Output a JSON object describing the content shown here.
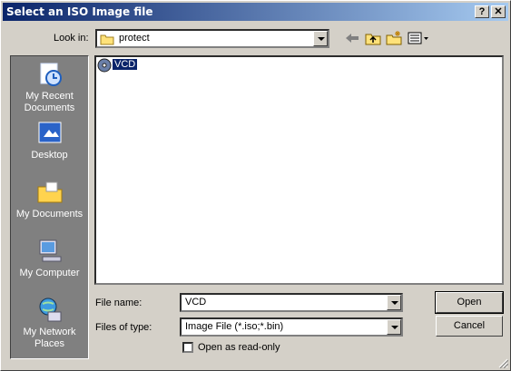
{
  "window": {
    "title": "Select an ISO Image file",
    "help_label": "?",
    "close_label": "✕"
  },
  "lookin": {
    "label": "Look in:",
    "value": "protect"
  },
  "places": [
    {
      "label1": "My Recent",
      "label2": "Documents",
      "icon": "recent-documents-icon"
    },
    {
      "label1": "Desktop",
      "label2": "",
      "icon": "desktop-icon"
    },
    {
      "label1": "My Documents",
      "label2": "",
      "icon": "my-documents-icon"
    },
    {
      "label1": "My Computer",
      "label2": "",
      "icon": "my-computer-icon"
    },
    {
      "label1": "My Network",
      "label2": "Places",
      "icon": "network-places-icon"
    }
  ],
  "files": [
    {
      "name": "VCD",
      "icon": "disc-icon",
      "selected": true
    }
  ],
  "filename": {
    "label": "File name:",
    "value": "VCD"
  },
  "filetype": {
    "label": "Files of type:",
    "value": "Image File (*.iso;*.bin)"
  },
  "readonly": {
    "label": "Open as read-only",
    "checked": false
  },
  "buttons": {
    "open": "Open",
    "cancel": "Cancel"
  },
  "colors": {
    "title_start": "#0a246a",
    "title_end": "#a6caf0",
    "selection": "#0a246a",
    "face": "#d4d0c8"
  }
}
